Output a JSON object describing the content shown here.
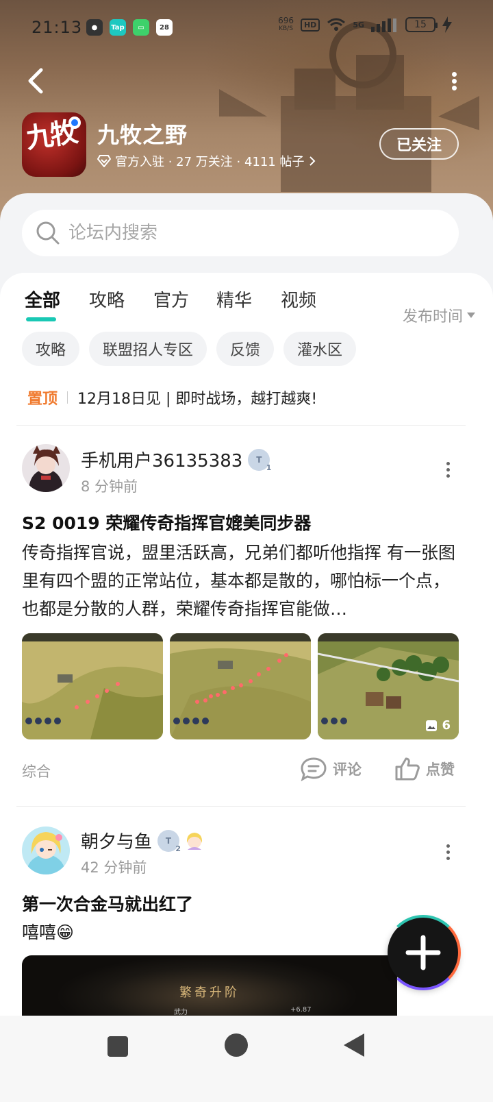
{
  "status_bar": {
    "time": "21:13",
    "speed_value": "696",
    "speed_unit": "KB/S",
    "hd_label": "HD",
    "network": "5G",
    "battery": "15"
  },
  "forum": {
    "name": "九牧之野",
    "icon_text": "九牧",
    "meta": "官方入驻 · 27 万关注 · 4111 帖子",
    "follow_label": "已关注"
  },
  "search": {
    "placeholder": "论坛内搜索"
  },
  "tabs": [
    {
      "label": "全部",
      "active": true
    },
    {
      "label": "攻略"
    },
    {
      "label": "官方"
    },
    {
      "label": "精华"
    },
    {
      "label": "视频"
    }
  ],
  "sort_label": "发布时间",
  "chips": [
    "攻略",
    "联盟招人专区",
    "反馈",
    "灌水区"
  ],
  "pinned": {
    "tag": "置顶",
    "text": "12月18日见 | 即时战场，越打越爽!"
  },
  "posts": [
    {
      "username": "手机用户36135383",
      "level": "1",
      "time": "8 分钟前",
      "title": "S2 0019 荣耀传奇指挥官媲美同步器",
      "body": "传奇指挥官说，盟里活跃高，兄弟们都听他指挥 有一张图里有四个盟的正常站位，基本都是散的，哪怕标一个点，也都是分散的人群，荣耀传奇指挥官能做…",
      "image_count": "6",
      "category": "综合",
      "comment_label": "评论",
      "like_label": "点赞"
    },
    {
      "username": "朝夕与鱼",
      "level": "2",
      "time": "42 分钟前",
      "title": "第一次合金马就出红了",
      "body": "嘻嘻😁",
      "image_title": "繁奇升阶",
      "image_left": "武力",
      "image_right": "+6.87"
    }
  ],
  "colors": {
    "accent": "#19c8b4",
    "pinned_tag": "#f07a2e",
    "follow_border": "#ffffff"
  }
}
